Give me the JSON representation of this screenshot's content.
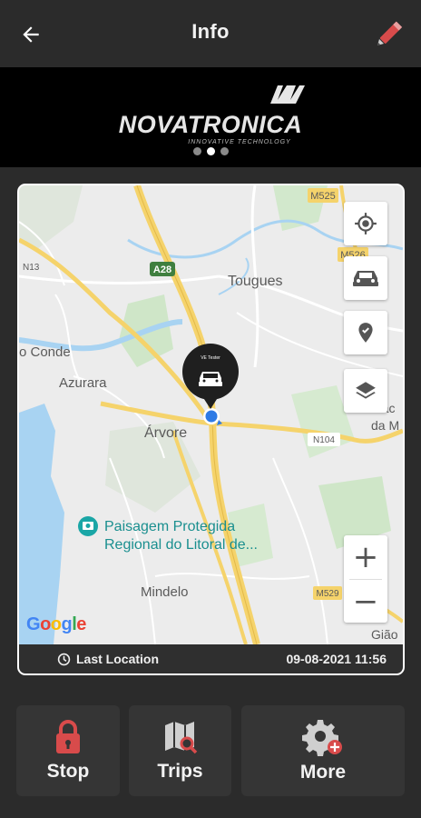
{
  "header": {
    "title": "Info",
    "back_icon": "arrow-left-icon",
    "edit_icon": "pencil-icon"
  },
  "banner": {
    "brand": "NOVATRONICA",
    "tagline": "INNOVATIVE TECHNOLOGY",
    "slides": 3,
    "active_slide": 1
  },
  "map": {
    "labels": {
      "m525": "M525",
      "m526": "M526",
      "n13": "N13",
      "a28": "A28",
      "tougues": "Tougues",
      "conde": "o Conde",
      "azurara": "Azurara",
      "arvore": "Árvore",
      "n104": "N104",
      "macieira": "Mac",
      "da_m": "da M",
      "paisagem1": "Paisagem Protegida",
      "paisagem2": "Regional do Litoral de...",
      "mindelo": "Mindelo",
      "m529": "M529",
      "giao": "Gião"
    },
    "vehicle_label": "VE Tester",
    "controls": [
      "my-location-icon",
      "car-icon",
      "pin-icon",
      "layers-icon"
    ],
    "zoom_in": "+",
    "zoom_out": "−",
    "attribution": "Google"
  },
  "location": {
    "label": "Last Location",
    "timestamp": "09-08-2021 11:56"
  },
  "actions": [
    {
      "label": "Stop",
      "icon": "lock-icon"
    },
    {
      "label": "Trips",
      "icon": "map-search-icon"
    },
    {
      "label": "More",
      "icon": "settings-add-icon"
    }
  ],
  "colors": {
    "background": "#2b2b2b",
    "accent_red": "#d84b4b",
    "road_yellow": "#f5d36b",
    "water": "#a8d3f2",
    "marker_blue": "#2f7be5"
  }
}
